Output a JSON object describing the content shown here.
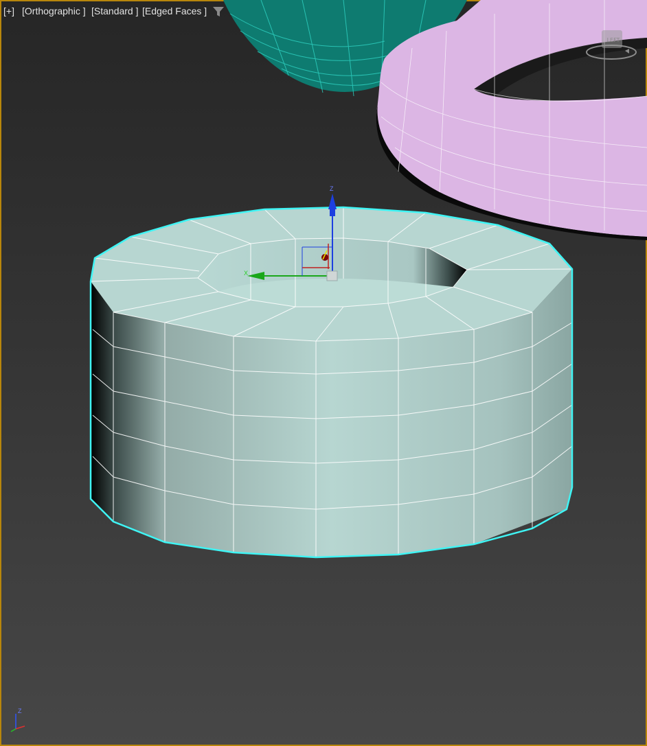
{
  "viewport": {
    "labels": {
      "plus": "[+]",
      "view": "[Orthographic ]",
      "shading": "[Standard ]",
      "display": "[Edged Faces ]"
    },
    "filter_icon": "funnel-icon",
    "viewcube": {
      "face": "LEFT"
    },
    "gizmo": {
      "z_label": "Z",
      "x_label": "X"
    },
    "corner_axis": {
      "label": "Z"
    }
  },
  "colors": {
    "teapot": "#0e7b70",
    "torus": "#dcb6e4",
    "tube": "#b7d6d1",
    "selection": "#3ff4f4",
    "frame": "#b8860b"
  }
}
